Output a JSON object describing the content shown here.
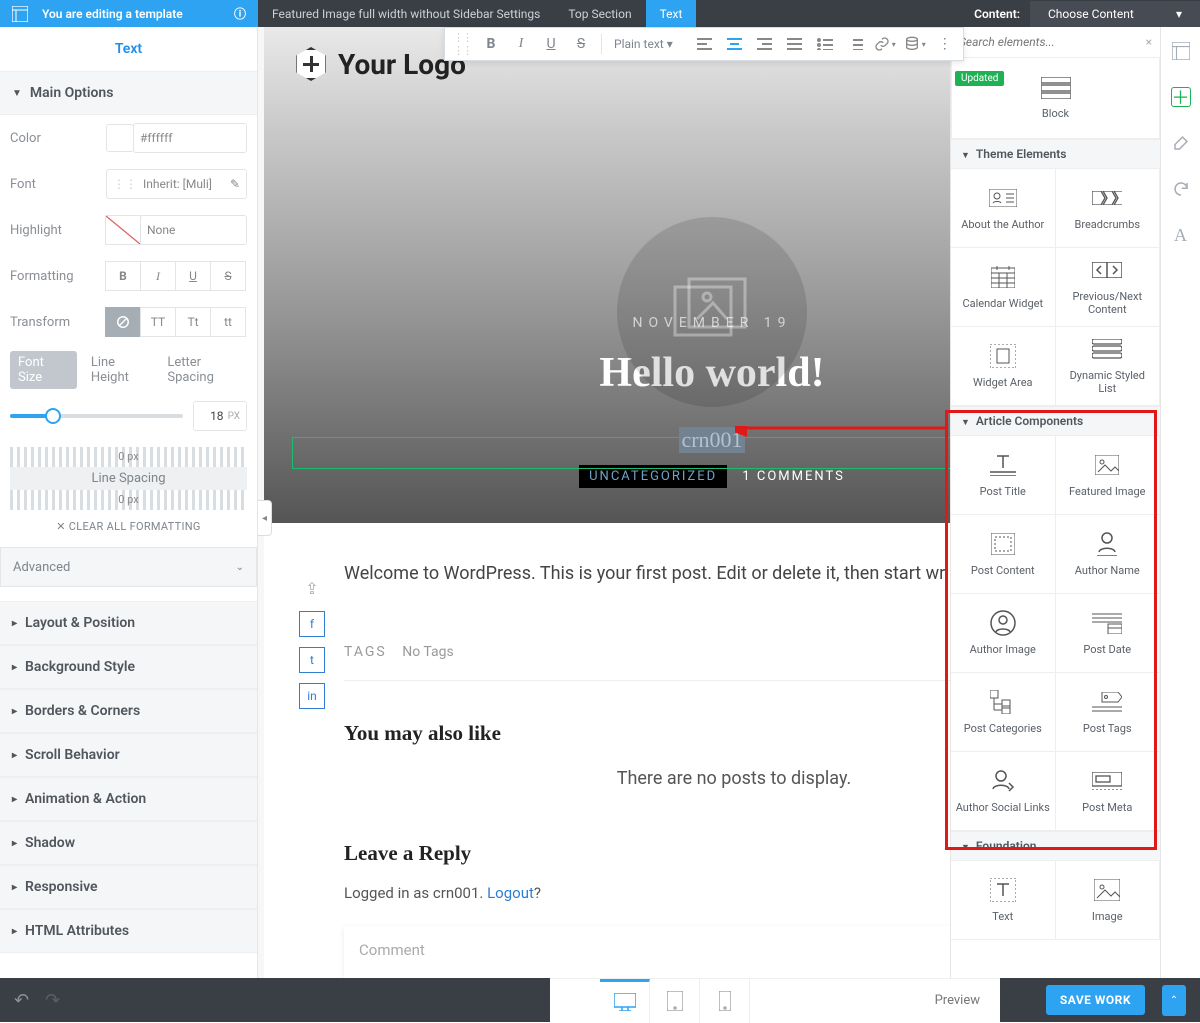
{
  "topbar": {
    "editing_label": "You are editing a template",
    "breadcrumbs": [
      "Featured Image full width without Sidebar Settings",
      "Top Section",
      "Text"
    ],
    "content_label": "Content:",
    "choose_content": "Choose Content"
  },
  "left": {
    "title": "Text",
    "main_options": "Main Options",
    "color_label": "Color",
    "color_value": "#ffffff",
    "font_label": "Font",
    "font_value": "Inherit: [Muli]",
    "highlight_label": "Highlight",
    "highlight_value": "None",
    "formatting_label": "Formatting",
    "transform_label": "Transform",
    "transform_opts": [
      "TT",
      "Tt",
      "tt"
    ],
    "fmt_opts": [
      "B",
      "I",
      "U",
      "S"
    ],
    "size_tabs": [
      "Font Size",
      "Line Height",
      "Letter Spacing"
    ],
    "font_size_value": "18",
    "font_size_unit": "PX",
    "zero_px": "0 px",
    "line_spacing": "Line Spacing",
    "clear": "CLEAR ALL FORMATTING",
    "advanced": "Advanced",
    "sections": [
      "Layout & Position",
      "Background Style",
      "Borders & Corners",
      "Scroll Behavior",
      "Animation & Action",
      "Shadow",
      "Responsive",
      "HTML Attributes"
    ]
  },
  "toolbar": {
    "format_select": "Plain text"
  },
  "canvas": {
    "logo_text": "Your Logo",
    "date": "NOVEMBER 19",
    "title": "Hello world!",
    "selected_text": "crn001",
    "category": "UNCATEGORIZED",
    "comments": "1 COMMENTS",
    "body": "Welcome to WordPress. This is your first post. Edit or delete it, then start wr",
    "tags_label": "TAGS",
    "no_tags": "No Tags",
    "also_like": "You may also like",
    "no_posts": "There are no posts to display.",
    "reply": "Leave a Reply",
    "logged_in_prefix": "Logged in as crn001. ",
    "logout": "Logout",
    "logged_in_suffix": "?",
    "comment_ph": "Comment"
  },
  "elements": {
    "search_ph": "Search elements...",
    "updated": "Updated",
    "block": "Block",
    "groups": {
      "theme": {
        "title": "Theme Elements",
        "items": [
          "About the Author",
          "Breadcrumbs",
          "Calendar Widget",
          "Previous/Next Content",
          "Widget Area",
          "Dynamic Styled List"
        ]
      },
      "article": {
        "title": "Article Components",
        "items": [
          "Post Title",
          "Featured Image",
          "Post Content",
          "Author Name",
          "Author Image",
          "Post Date",
          "Post Categories",
          "Post Tags",
          "Author Social Links",
          "Post Meta"
        ]
      },
      "foundation": {
        "title": "Foundation",
        "items": [
          "Text",
          "Image"
        ]
      }
    }
  },
  "footer": {
    "save": "SAVE WORK",
    "preview": "Preview"
  }
}
